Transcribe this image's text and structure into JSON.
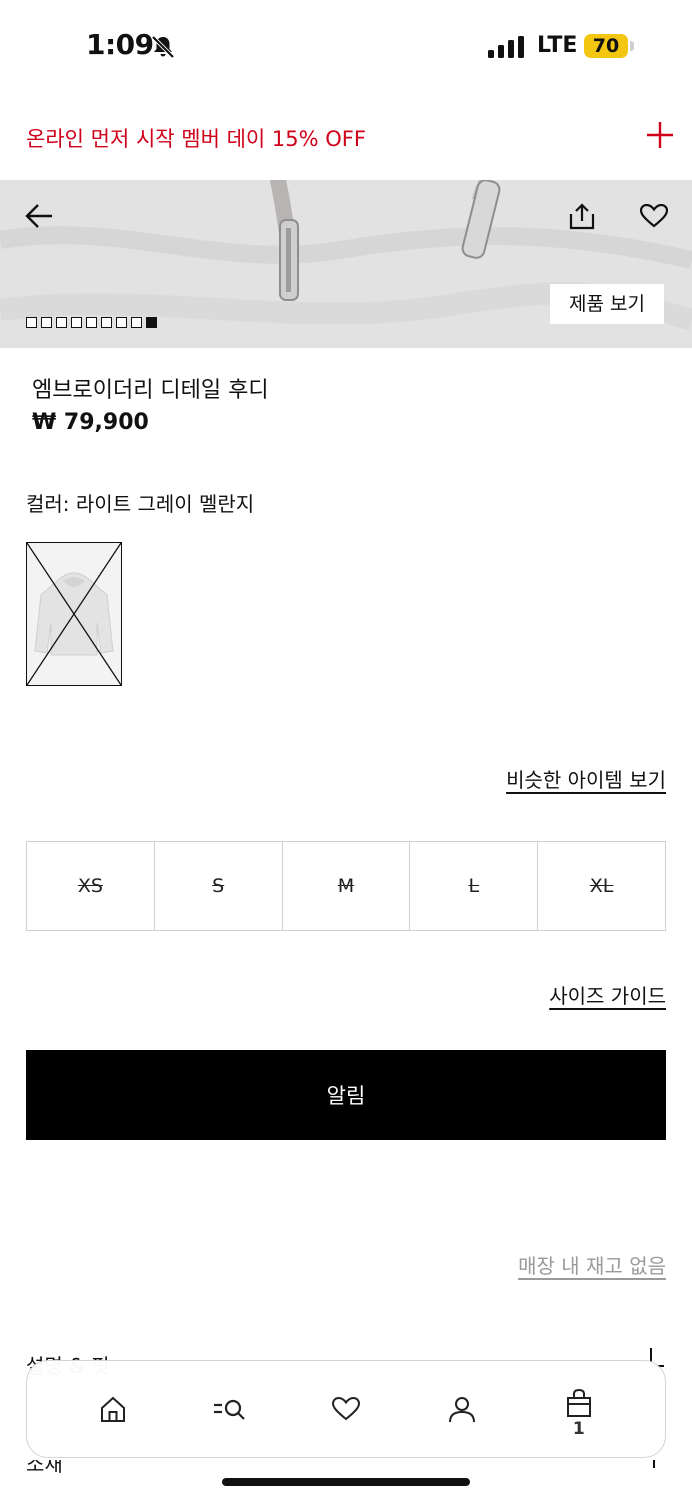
{
  "status_bar": {
    "time": "1:09",
    "network": "LTE",
    "battery": "70",
    "icons": [
      "bell-slash-icon",
      "signal-icon"
    ]
  },
  "promo": {
    "text": "온라인 먼저 시작 멤버 데이 15% OFF",
    "color": "#d0021b",
    "expand_icon": "plus-icon"
  },
  "hero": {
    "back_icon": "arrow-left-icon",
    "share_icon": "share-icon",
    "wishlist_icon": "heart-icon",
    "view_product_label": "제품 보기",
    "image_count": 9,
    "active_image": 9
  },
  "product": {
    "name": "엠브로이더리 디테일 후디",
    "price": "₩ 79,900",
    "color_label": "컬러: 라이트 그레이 멜란지",
    "swatch_unavailable": true
  },
  "links": {
    "similar": "비슷한 아이템 보기",
    "size_guide": "사이즈 가이드",
    "store_stock": "매장 내 재고 없음"
  },
  "sizes": [
    {
      "label": "XS",
      "available": false
    },
    {
      "label": "S",
      "available": false
    },
    {
      "label": "M",
      "available": false
    },
    {
      "label": "L",
      "available": false
    },
    {
      "label": "XL",
      "available": false
    }
  ],
  "notify_button": "알림",
  "accordion": [
    {
      "label": "설명 & 핏",
      "icon": "minus-icon"
    },
    {
      "label": "소재",
      "icon": "plus-icon"
    }
  ],
  "bottom_nav": {
    "items": [
      "home-icon",
      "menu-search-icon",
      "heart-icon",
      "user-icon",
      "shopping-bag-icon"
    ],
    "cart_count": "1"
  }
}
